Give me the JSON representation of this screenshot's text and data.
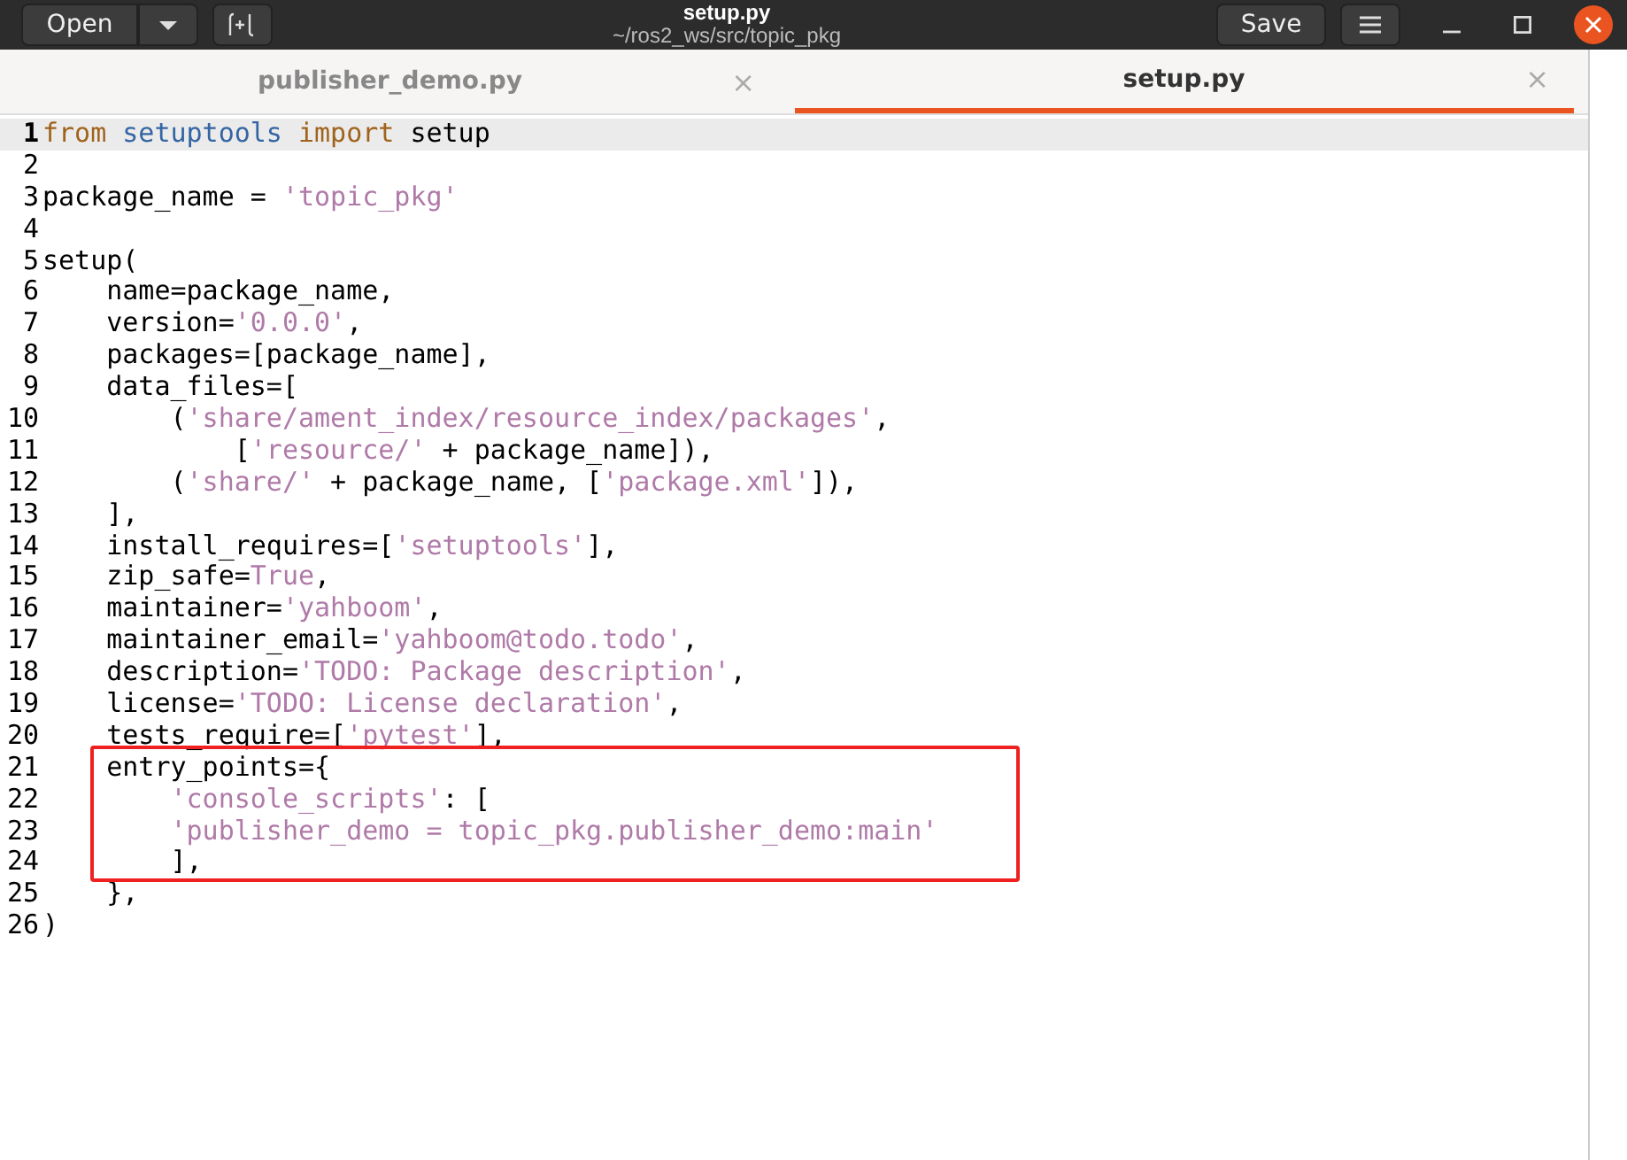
{
  "window": {
    "title": "setup.py",
    "subtitle": "~/ros2_ws/src/topic_pkg",
    "open_button": "Open",
    "save_button": "Save"
  },
  "tabs": [
    {
      "label": "publisher_demo.py",
      "selected": false,
      "close": "×"
    },
    {
      "label": "setup.py",
      "selected": true,
      "close": "×"
    }
  ],
  "lines": [
    {
      "number": "1",
      "current": true,
      "boxed": false,
      "tokens": [
        {
          "kind": "keyword",
          "text": "from "
        },
        {
          "kind": "module",
          "text": "setuptools "
        },
        {
          "kind": "keyword",
          "text": "import"
        },
        {
          "kind": "plain",
          "text": " setup"
        }
      ]
    },
    {
      "number": "2",
      "current": false,
      "boxed": false
    },
    {
      "number": "3",
      "current": false,
      "boxed": false,
      "tokens": [
        {
          "kind": "plain",
          "text": "package_name = "
        },
        {
          "kind": "string",
          "text": "'topic_pkg'"
        }
      ]
    },
    {
      "number": "4",
      "current": false,
      "boxed": false
    },
    {
      "number": "5",
      "current": false,
      "boxed": false,
      "tokens": [
        {
          "kind": "plain",
          "text": "setup("
        }
      ]
    },
    {
      "number": "6",
      "current": false,
      "boxed": false,
      "tokens": [
        {
          "kind": "plain",
          "text": "    name=package_name,"
        }
      ]
    },
    {
      "number": "7",
      "current": false,
      "boxed": false,
      "tokens": [
        {
          "kind": "plain",
          "text": "    version="
        },
        {
          "kind": "string",
          "text": "'0.0.0'"
        },
        {
          "kind": "plain",
          "text": ","
        }
      ]
    },
    {
      "number": "8",
      "current": false,
      "boxed": false,
      "tokens": [
        {
          "kind": "plain",
          "text": "    packages=[package_name],"
        }
      ]
    },
    {
      "number": "9",
      "current": false,
      "boxed": false,
      "tokens": [
        {
          "kind": "plain",
          "text": "    data_files=["
        }
      ]
    },
    {
      "number": "10",
      "current": false,
      "boxed": false,
      "tokens": [
        {
          "kind": "plain",
          "text": "        ("
        },
        {
          "kind": "string",
          "text": "'share/ament_index/resource_index/packages'"
        },
        {
          "kind": "plain",
          "text": ","
        }
      ]
    },
    {
      "number": "11",
      "current": false,
      "boxed": false,
      "tokens": [
        {
          "kind": "plain",
          "text": "            ["
        },
        {
          "kind": "string",
          "text": "'resource/'"
        },
        {
          "kind": "plain",
          "text": " + package_name]),"
        }
      ]
    },
    {
      "number": "12",
      "current": false,
      "boxed": false,
      "tokens": [
        {
          "kind": "plain",
          "text": "        ("
        },
        {
          "kind": "string",
          "text": "'share/'"
        },
        {
          "kind": "plain",
          "text": " + package_name, ["
        },
        {
          "kind": "string",
          "text": "'package.xml'"
        },
        {
          "kind": "plain",
          "text": "]),"
        }
      ]
    },
    {
      "number": "13",
      "current": false,
      "boxed": false,
      "tokens": [
        {
          "kind": "plain",
          "text": "    ],"
        }
      ]
    },
    {
      "number": "14",
      "current": false,
      "boxed": false,
      "tokens": [
        {
          "kind": "plain",
          "text": "    install_requires=["
        },
        {
          "kind": "string",
          "text": "'setuptools'"
        },
        {
          "kind": "plain",
          "text": "],"
        }
      ]
    },
    {
      "number": "15",
      "current": false,
      "boxed": false,
      "tokens": [
        {
          "kind": "plain",
          "text": "    zip_safe="
        },
        {
          "kind": "string",
          "text": "True"
        },
        {
          "kind": "plain",
          "text": ","
        }
      ]
    },
    {
      "number": "16",
      "current": false,
      "boxed": false,
      "tokens": [
        {
          "kind": "plain",
          "text": "    maintainer="
        },
        {
          "kind": "string",
          "text": "'yahboom'"
        },
        {
          "kind": "plain",
          "text": ","
        }
      ]
    },
    {
      "number": "17",
      "current": false,
      "boxed": false,
      "tokens": [
        {
          "kind": "plain",
          "text": "    maintainer_email="
        },
        {
          "kind": "string",
          "text": "'yahboom@todo.todo'"
        },
        {
          "kind": "plain",
          "text": ","
        }
      ]
    },
    {
      "number": "18",
      "current": false,
      "boxed": false,
      "tokens": [
        {
          "kind": "plain",
          "text": "    description="
        },
        {
          "kind": "string",
          "text": "'TODO: Package description'"
        },
        {
          "kind": "plain",
          "text": ","
        }
      ]
    },
    {
      "number": "19",
      "current": false,
      "boxed": false,
      "tokens": [
        {
          "kind": "plain",
          "text": "    license="
        },
        {
          "kind": "string",
          "text": "'TODO: License declaration'"
        },
        {
          "kind": "plain",
          "text": ","
        }
      ]
    },
    {
      "number": "20",
      "current": false,
      "boxed": false,
      "tokens": [
        {
          "kind": "plain",
          "text": "    tests_require=["
        },
        {
          "kind": "string",
          "text": "'pytest'"
        },
        {
          "kind": "plain",
          "text": "],"
        }
      ]
    },
    {
      "number": "21",
      "current": false,
      "boxed": true,
      "tokens": [
        {
          "kind": "plain",
          "text": "    entry_points={"
        }
      ]
    },
    {
      "number": "22",
      "current": false,
      "boxed": true,
      "tokens": [
        {
          "kind": "string",
          "text": "        'console_scripts'"
        },
        {
          "kind": "plain",
          "text": ": ["
        }
      ]
    },
    {
      "number": "23",
      "current": false,
      "boxed": true,
      "tokens": [
        {
          "kind": "string",
          "text": "        'publisher_demo = topic_pkg.publisher_demo:main'"
        }
      ]
    },
    {
      "number": "24",
      "current": false,
      "boxed": true,
      "tokens": [
        {
          "kind": "plain",
          "text": "        ],"
        }
      ]
    },
    {
      "number": "25",
      "current": false,
      "boxed": false,
      "tokens": [
        {
          "kind": "plain",
          "text": "    },"
        }
      ]
    },
    {
      "number": "26",
      "current": false,
      "boxed": false,
      "tokens": [
        {
          "kind": "plain",
          "text": ")"
        }
      ]
    }
  ]
}
